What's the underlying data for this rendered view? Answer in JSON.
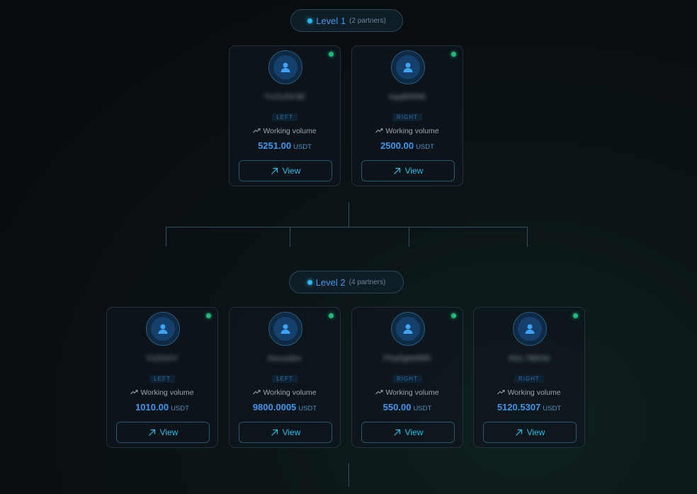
{
  "levels": [
    {
      "label": "Level 1",
      "count_text": "(2 partners)",
      "partners": [
        {
          "name": "7U2U9X3E",
          "side": "LEFT",
          "volume_label": "Working volume",
          "amount": "5251.00",
          "currency": "USDT",
          "view_label": "View"
        },
        {
          "name": "sqq89999",
          "side": "RIGHT",
          "volume_label": "Working volume",
          "amount": "2500.00",
          "currency": "USDT",
          "view_label": "View"
        }
      ]
    },
    {
      "label": "Level 2",
      "count_text": "(4 partners)",
      "partners": [
        {
          "name": "YiiZGGY",
          "side": "LEFT",
          "volume_label": "Working volume",
          "amount": "1010.00",
          "currency": "USDT",
          "view_label": "View"
        },
        {
          "name": "Asuusbiv",
          "side": "LEFT",
          "volume_label": "Working volume",
          "amount": "9800.0005",
          "currency": "USDT",
          "view_label": "View"
        },
        {
          "name": "Fhytfgkbf8f9",
          "side": "RIGHT",
          "volume_label": "Working volume",
          "amount": "550.00",
          "currency": "USDT",
          "view_label": "View"
        },
        {
          "name": "0GL7BE0d",
          "side": "RIGHT",
          "volume_label": "Working volume",
          "amount": "5120.5307",
          "currency": "USDT",
          "view_label": "View"
        }
      ]
    }
  ],
  "icons": {
    "avatar": "user-icon",
    "status": "online-status-dot",
    "trend": "trending-up-icon",
    "view": "arrow-up-right-icon"
  },
  "colors": {
    "accent": "#3d97ee",
    "button_text": "#26bfe6",
    "online": "#1fb97a",
    "background": "#0a0f14"
  }
}
